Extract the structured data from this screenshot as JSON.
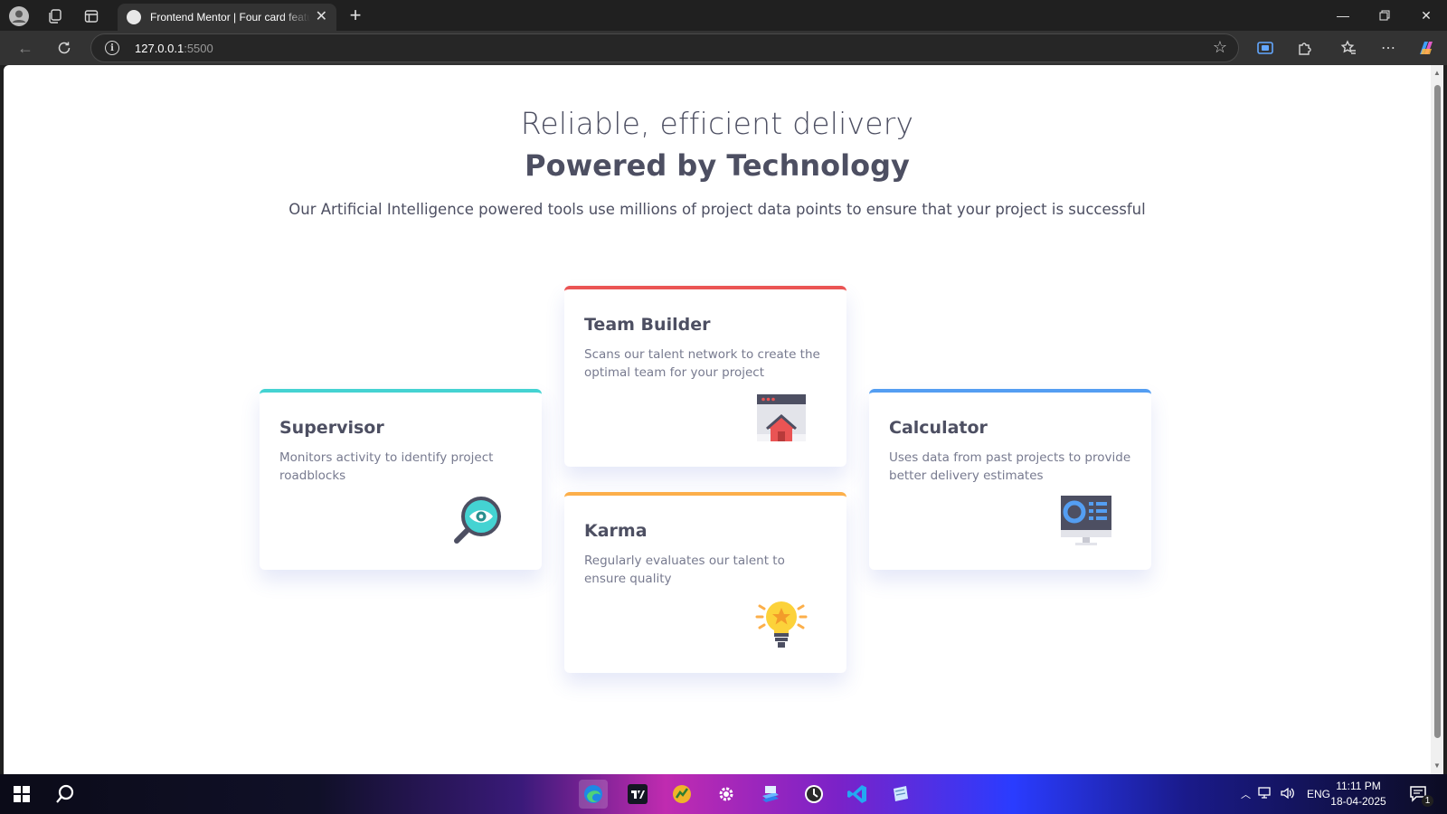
{
  "browser": {
    "tab_title": "Frontend Mentor | Four card feature section",
    "url_host": "127.0.0.1",
    "url_port": ":5500"
  },
  "page": {
    "heading_light": "Reliable, efficient delivery",
    "heading_bold": "Powered by Technology",
    "intro": "Our Artificial Intelligence powered tools use millions of project data points to ensure that your project is successful",
    "cards": [
      {
        "title": "Supervisor",
        "text": "Monitors activity to identify project roadblocks",
        "accent": "#44d3d2",
        "icon": "magnifier-eye-icon"
      },
      {
        "title": "Team Builder",
        "text": "Scans our talent network to create the optimal team for your project",
        "accent": "#ea5454",
        "icon": "browser-home-icon"
      },
      {
        "title": "Karma",
        "text": "Regularly evaluates our talent to ensure quality",
        "accent": "#fcaf4a",
        "icon": "lightbulb-icon"
      },
      {
        "title": "Calculator",
        "text": "Uses data from past projects to provide better delivery estimates",
        "accent": "#549ef2",
        "icon": "monitor-chart-icon"
      }
    ]
  },
  "taskbar": {
    "language": "ENG",
    "time": "11:11 PM",
    "date": "18-04-2025",
    "notification_count": "1"
  }
}
